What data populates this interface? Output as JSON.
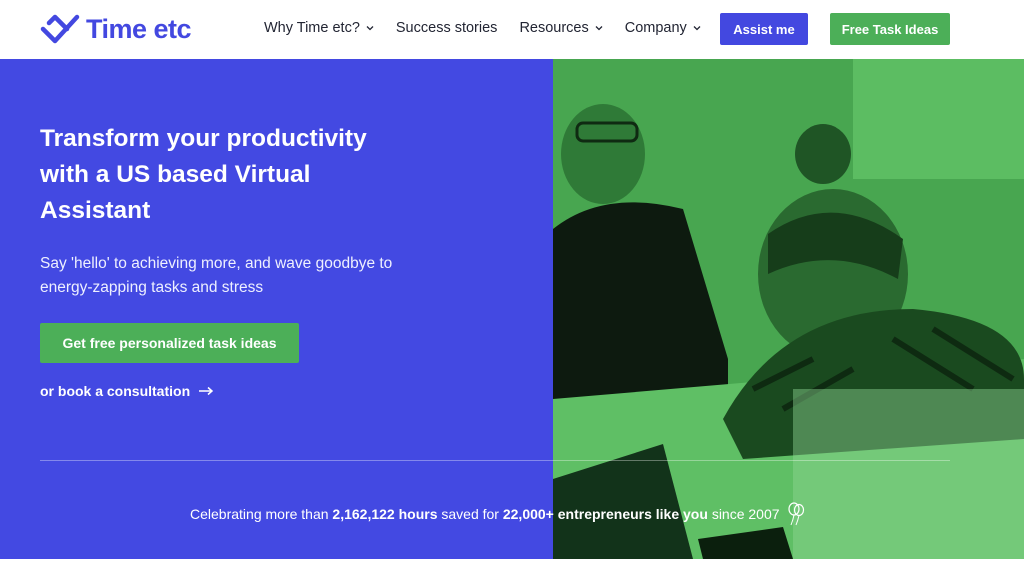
{
  "brand": {
    "name": "Time etc",
    "color": "#4348e0"
  },
  "nav": {
    "links": [
      {
        "label": "Why Time etc?",
        "has_dropdown": true
      },
      {
        "label": "Success stories",
        "has_dropdown": false
      },
      {
        "label": "Resources",
        "has_dropdown": true
      },
      {
        "label": "Company",
        "has_dropdown": true
      }
    ],
    "assist_button": "Assist me",
    "ideas_button": "Free Task Ideas"
  },
  "hero": {
    "title": "Transform your productivity with a US based Virtual Assistant",
    "subtitle": "Say 'hello' to achieving more, and wave goodbye to energy-zapping tasks and stress",
    "cta": "Get free personalized task ideas",
    "secondary_link": "or book a consultation",
    "bg_color": "#4349e2",
    "cta_color": "#4caf58"
  },
  "stats": {
    "prefix": "Celebrating more than",
    "hours": "2,162,122 hours",
    "middle": "saved for",
    "entrepreneurs": "22,000+ entrepreneurs like you",
    "suffix": "since 2007"
  },
  "icons": [
    "logo-check-mark",
    "chevron-down-icon",
    "arrow-right-icon",
    "balloon-icon"
  ]
}
